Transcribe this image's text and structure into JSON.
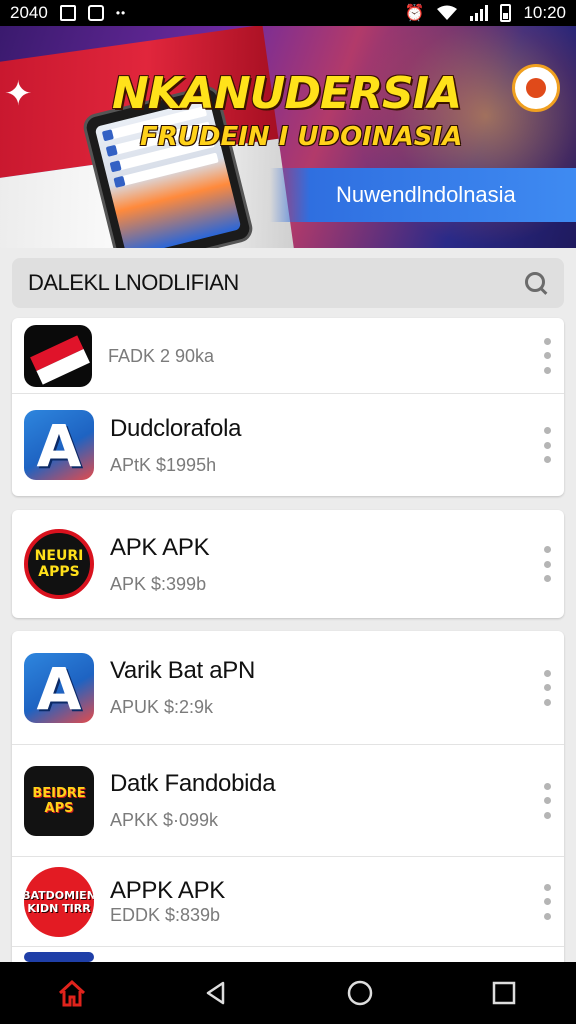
{
  "status_bar": {
    "time_left": "2040",
    "time_right": "10:20"
  },
  "banner": {
    "title": "NKANUDERSIA",
    "subtitle": "FRUDEIN I UDOINASIA",
    "pill": "Nuwendlndolnasia"
  },
  "search": {
    "value": "DALEKL LNODLIFIAN",
    "icon": "search-icon"
  },
  "cards": [
    {
      "items": [
        {
          "title": "",
          "subtitle": "FADK 2 90ka",
          "icon": "indonesia-flag-app-icon"
        },
        {
          "title": "Dudclorafola",
          "subtitle": "APtK $1995h",
          "icon": "blue-a-app-icon"
        }
      ]
    },
    {
      "items": [
        {
          "title": "APK APK",
          "subtitle": "APK $:399b",
          "icon": "nuri-apps-icon",
          "icon_text": "NEURI APPS"
        }
      ]
    },
    {
      "items": [
        {
          "title": "Varik Bat aPN",
          "subtitle": "APUK $:2:9k",
          "icon": "blue-a-app-icon"
        },
        {
          "title": "Datk Fandobida",
          "subtitle": "APKK $·099k",
          "icon": "colorful-text-app-icon",
          "icon_text": "BEIDRE APS"
        },
        {
          "title": "APPK APK",
          "subtitle": "EDDK $:839b",
          "icon": "red-round-app-icon",
          "icon_text": "BATDOMIEN KIDN TIRR"
        }
      ]
    }
  ],
  "nav": {
    "home": "home-icon",
    "back": "back-icon",
    "recents_home": "home-circle-icon",
    "overview": "overview-icon"
  },
  "colors": {
    "accent": "#2f6fe0",
    "flag_red": "#e0132a",
    "home_active": "#e0231c"
  }
}
